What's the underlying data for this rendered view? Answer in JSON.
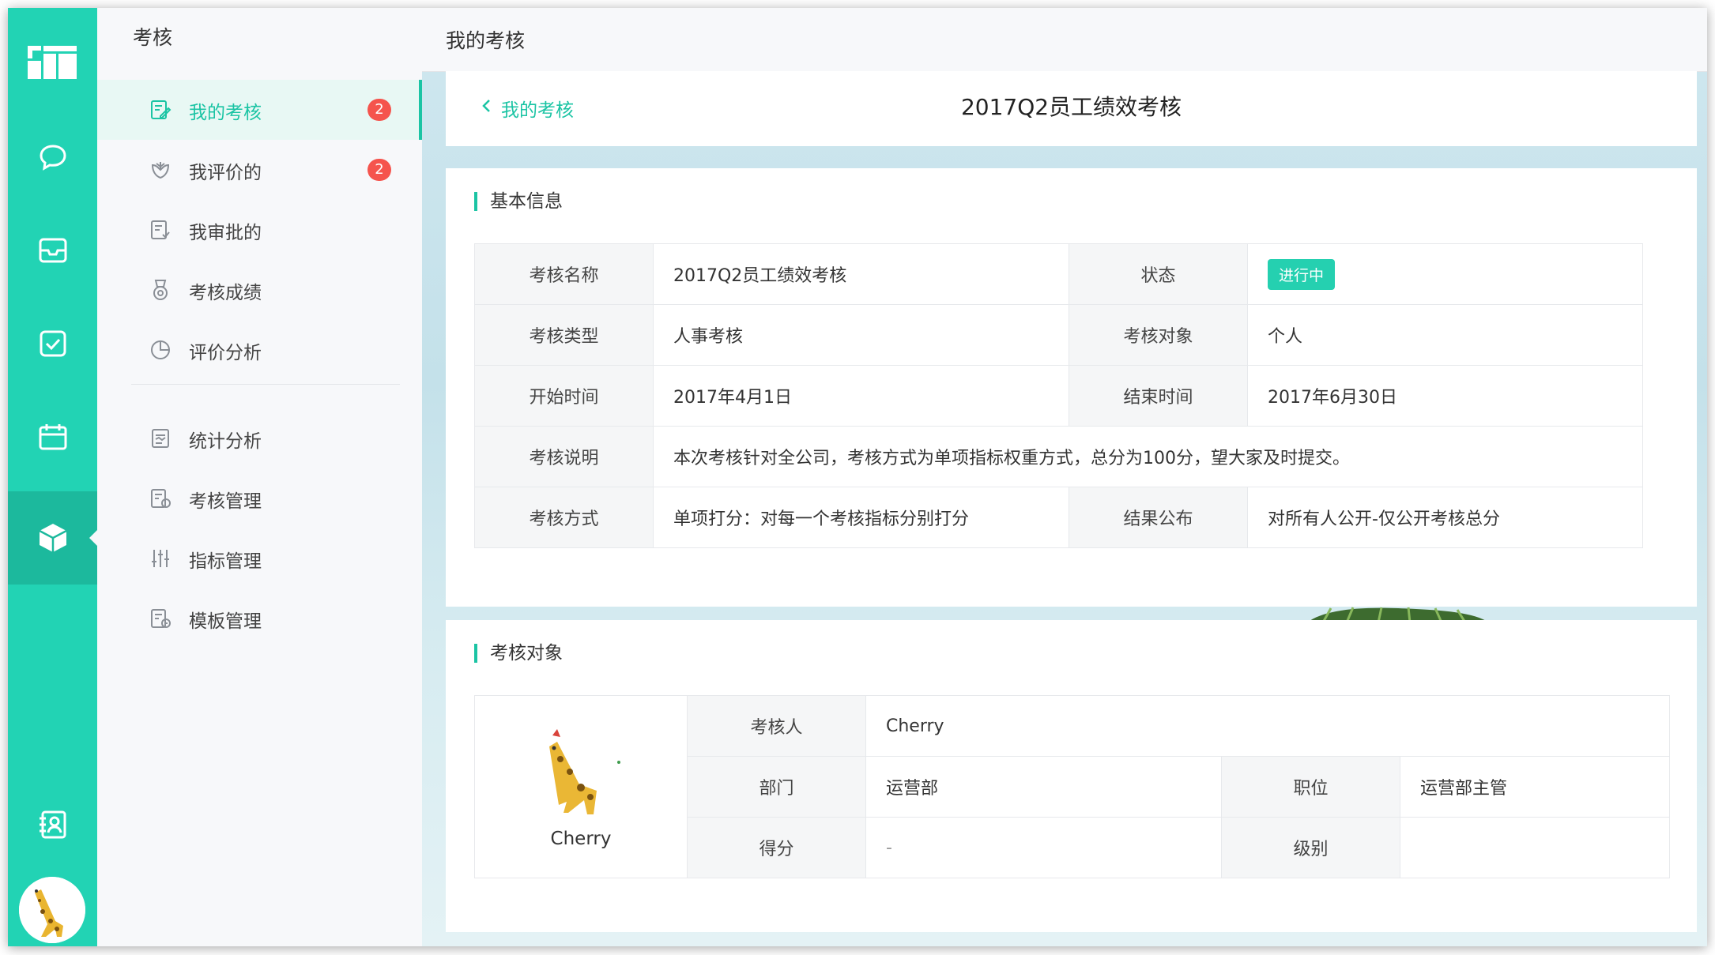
{
  "sidebar_rail": {
    "icons": [
      "logo-icon",
      "chat-icon",
      "inbox-icon",
      "check-icon",
      "calendar-icon",
      "cube-icon",
      "contacts-icon"
    ],
    "active": "cube-icon"
  },
  "nav": {
    "title": "考核",
    "items": [
      {
        "label": "我的考核",
        "badge": "2",
        "icon": "edit-icon"
      },
      {
        "label": "我评价的",
        "badge": "2",
        "icon": "flower-icon"
      },
      {
        "label": "我审批的",
        "icon": "approve-icon"
      },
      {
        "label": "考核成绩",
        "icon": "medal-icon"
      },
      {
        "label": "评价分析",
        "icon": "pie-icon"
      },
      {
        "label": "统计分析",
        "icon": "report-icon"
      },
      {
        "label": "考核管理",
        "icon": "manage-icon"
      },
      {
        "label": "指标管理",
        "icon": "sliders-icon"
      },
      {
        "label": "模板管理",
        "icon": "template-icon"
      }
    ]
  },
  "topbar": {
    "title": "我的考核"
  },
  "header": {
    "back_label": "我的考核",
    "title": "2017Q2员工绩效考核"
  },
  "basic_info": {
    "section_title": "基本信息",
    "name_label": "考核名称",
    "name": "2017Q2员工绩效考核",
    "status_label": "状态",
    "status": "进行中",
    "type_label": "考核类型",
    "type": "人事考核",
    "target_label": "考核对象",
    "target": "个人",
    "start_label": "开始时间",
    "start": "2017年4月1日",
    "end_label": "结束时间",
    "end": "2017年6月30日",
    "desc_label": "考核说明",
    "desc": "本次考核针对全公司，考核方式为单项指标权重方式，总分为100分，望大家及时提交。",
    "method_label": "考核方式",
    "method": "单项打分：对每一个考核指标分别打分",
    "publish_label": "结果公布",
    "publish": "对所有人公开-仅公开考核总分"
  },
  "target_section": {
    "section_title": "考核对象",
    "avatar_name": "Cherry",
    "person_label": "考核人",
    "person": "Cherry",
    "dept_label": "部门",
    "dept": "运营部",
    "position_label": "职位",
    "position": "运营部主管",
    "score_label": "得分",
    "score": "-",
    "level_label": "级别",
    "level": ""
  },
  "colors": {
    "accent": "#22d3b4",
    "badge": "#f5544d"
  }
}
